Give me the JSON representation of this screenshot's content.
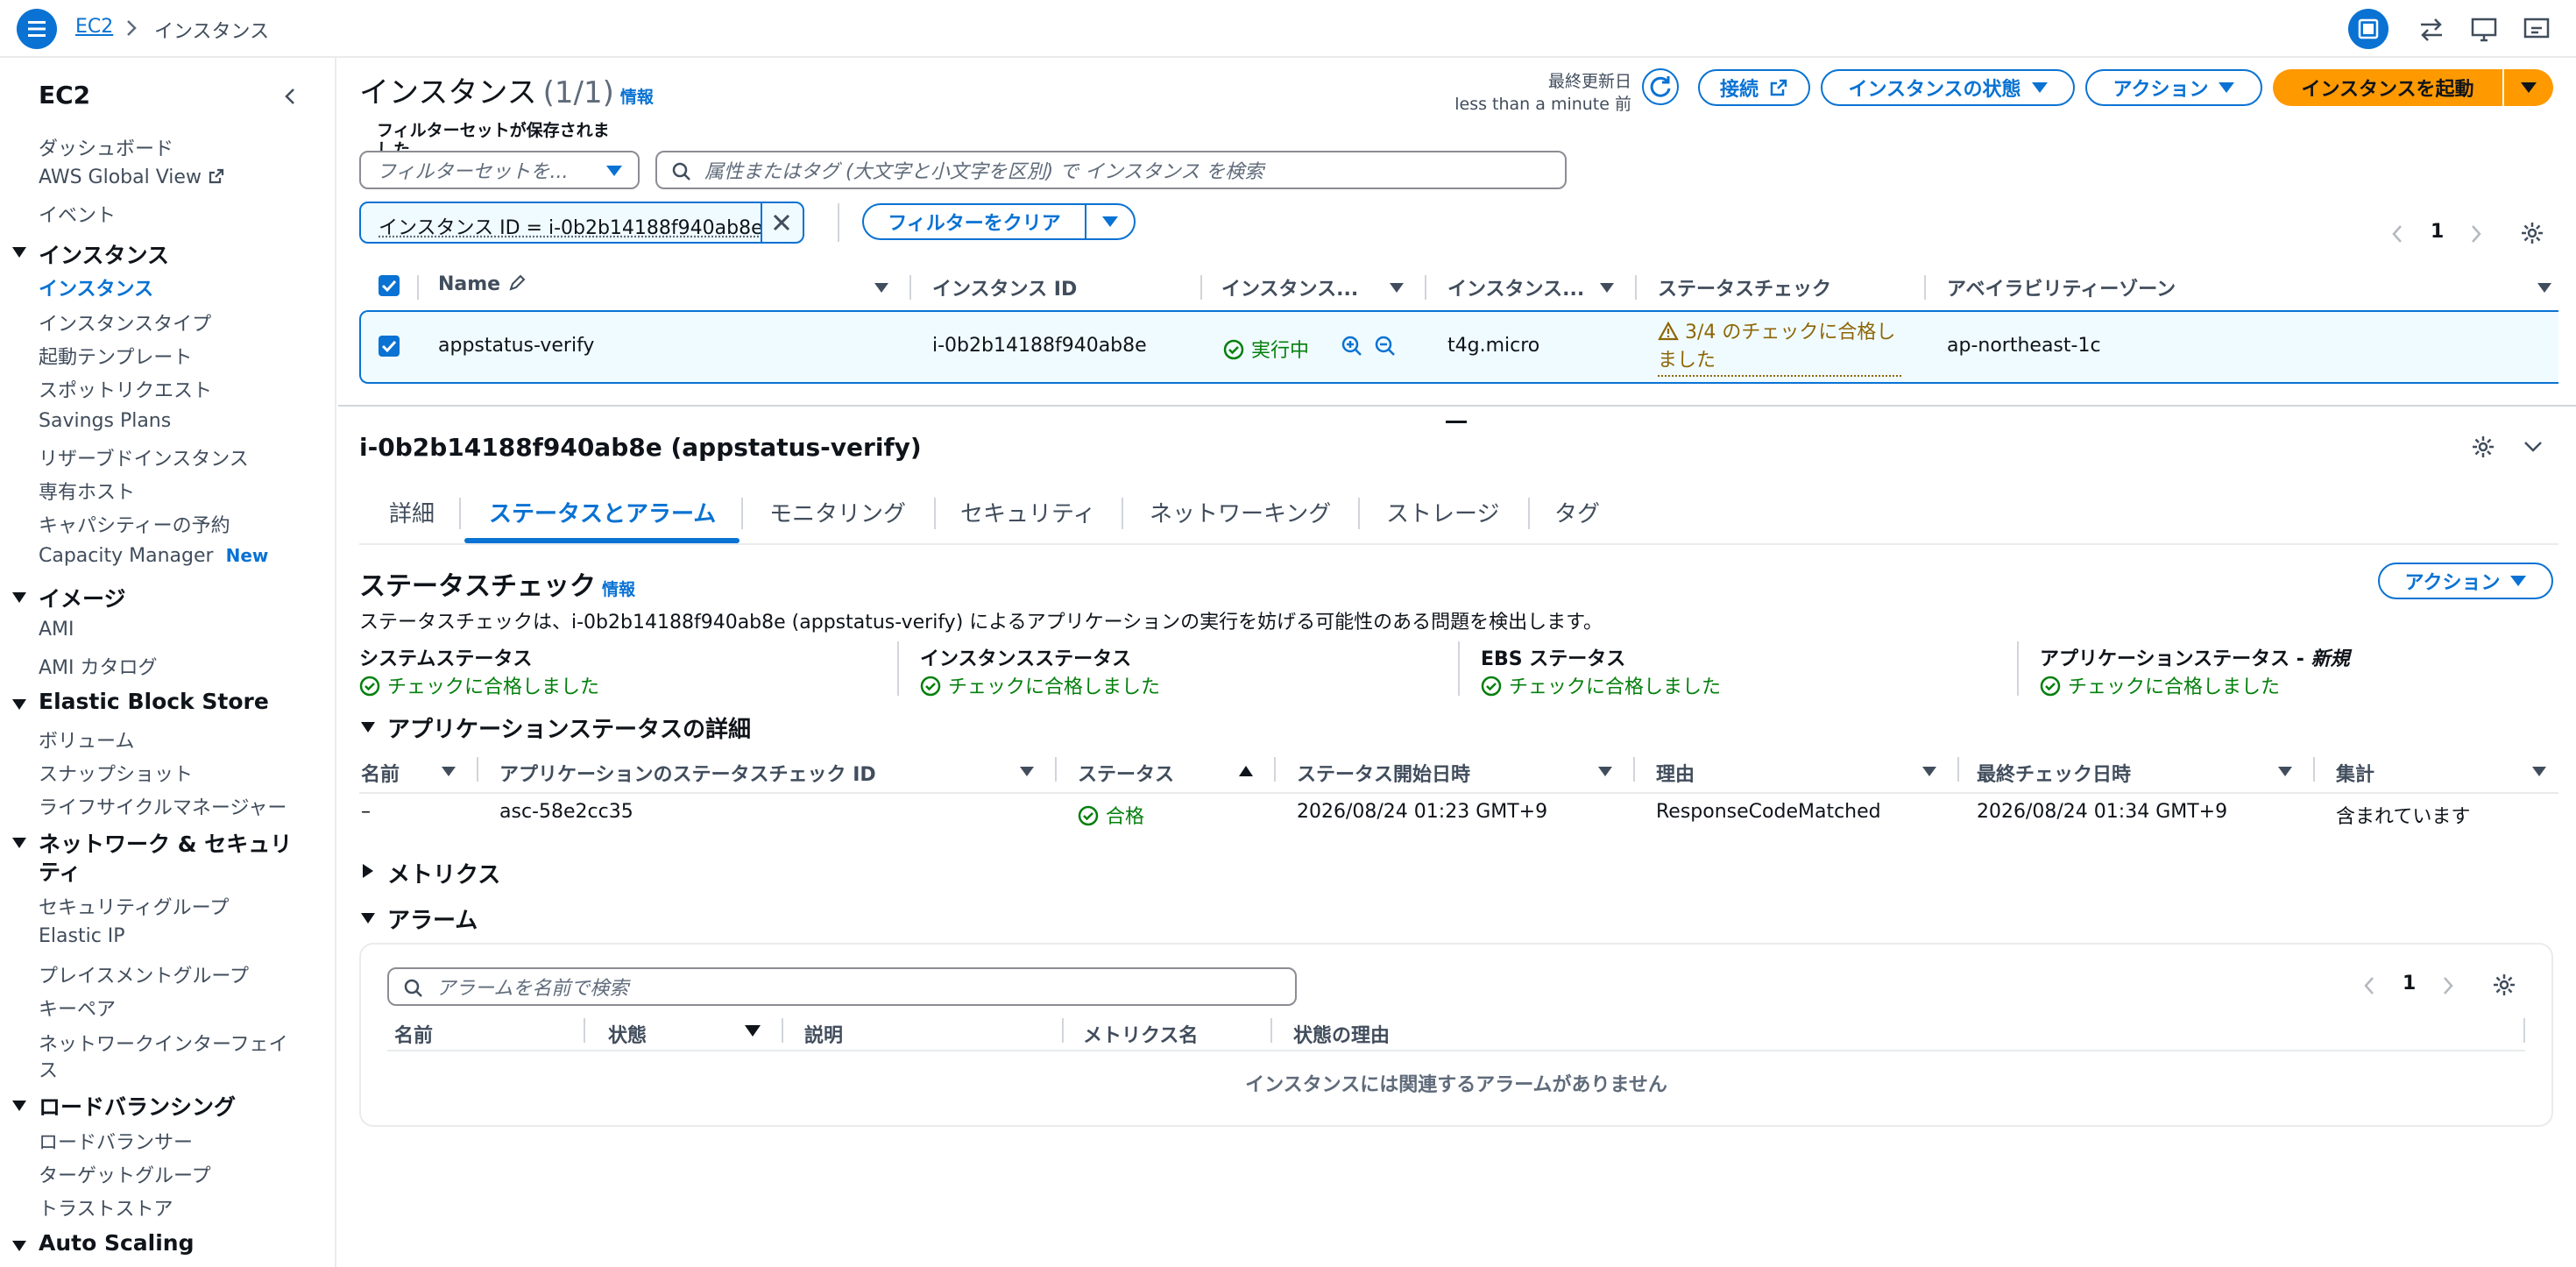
{
  "topbar": {
    "breadcrumb_root": "EC2",
    "breadcrumb_current": "インスタンス"
  },
  "sidebar": {
    "title": "EC2",
    "top_items": [
      "ダッシュボード",
      "AWS Global View",
      "イベント"
    ],
    "sections": [
      {
        "title": "インスタンス",
        "items": [
          "インスタンス",
          "インスタンスタイプ",
          "起動テンプレート",
          "スポットリクエスト",
          "Savings Plans",
          "リザーブドインスタンス",
          "専有ホスト",
          "キャパシティーの予約",
          "Capacity Manager"
        ]
      },
      {
        "title": "イメージ",
        "items": [
          "AMI",
          "AMI カタログ"
        ]
      },
      {
        "title": "Elastic Block Store",
        "items": [
          "ボリューム",
          "スナップショット",
          "ライフサイクルマネージャー"
        ]
      },
      {
        "title_line1": "ネットワーク & セキュリ",
        "title_line2": "ティ",
        "items": [
          "セキュリティグループ",
          "Elastic IP",
          "プレイスメントグループ",
          "キーペア",
          "ネットワークインターフェイ",
          "ス"
        ]
      },
      {
        "title": "ロードバランシング",
        "items": [
          "ロードバランサー",
          "ターゲットグループ",
          "トラストストア"
        ]
      },
      {
        "title": "Auto Scaling"
      }
    ],
    "new_badge": "New"
  },
  "header": {
    "title": "インスタンス",
    "count": "(1/1)",
    "info": "情報",
    "last_updated_label": "最終更新日",
    "last_updated_value": "less than a minute 前",
    "connect": "接続",
    "instance_state": "インスタンスの状態",
    "actions": "アクション",
    "launch": "インスタンスを起動"
  },
  "filters": {
    "saved_label_line1": "フィルターセットが保存されま",
    "saved_label_line2": "した",
    "saved_placeholder": "フィルターセットを...",
    "search_placeholder": "属性またはタグ (大文字と小文字を区別) で インスタンス を検索",
    "token": "インスタンス ID = i-0b2b14188f940ab8e",
    "clear": "フィルターをクリア",
    "page": "1"
  },
  "table": {
    "headers": [
      "Name",
      "インスタンス ID",
      "インスタンス...",
      "インスタンス...",
      "ステータスチェック",
      "アベイラビリティーゾーン"
    ],
    "row": {
      "name": "appstatus-verify",
      "id": "i-0b2b14188f940ab8e",
      "state": "実行中",
      "type": "t4g.micro",
      "checks_line1": "3/4 のチェックに合格し",
      "checks_line2": "ました",
      "az": "ap-northeast-1c"
    }
  },
  "detail": {
    "title": "i-0b2b14188f940ab8e (appstatus-verify)",
    "tabs": [
      "詳細",
      "ステータスとアラーム",
      "モニタリング",
      "セキュリティ",
      "ネットワーキング",
      "ストレージ",
      "タグ"
    ],
    "status_title": "ステータスチェック",
    "info": "情報",
    "actions": "アクション",
    "description": "ステータスチェックは、i-0b2b14188f940ab8e (appstatus-verify) によるアプリケーションの実行を妨げる可能性のある問題を検出します。",
    "checks": [
      {
        "label": "システムステータス",
        "value": "チェックに合格しました"
      },
      {
        "label": "インスタンスステータス",
        "value": "チェックに合格しました"
      },
      {
        "label": "EBS ステータス",
        "value": "チェックに合格しました"
      },
      {
        "label": "アプリケーションステータス - ",
        "label_em": "新規",
        "value": "チェックに合格しました"
      }
    ],
    "app_section": "アプリケーションステータスの詳細",
    "app_headers": [
      "名前",
      "アプリケーションのステータスチェック ID",
      "ステータス",
      "ステータス開始日時",
      "理由",
      "最終チェック日時",
      "集計"
    ],
    "app_row": {
      "name": "–",
      "id": "asc-58e2cc35",
      "status": "合格",
      "start": "2026/08/24 01:23 GMT+9",
      "reason": "ResponseCodeMatched",
      "last": "2026/08/24 01:34 GMT+9",
      "agg": "含まれています"
    },
    "metrics": "メトリクス",
    "alarms": "アラーム",
    "alarm_search": "アラームを名前で検索",
    "alarm_page": "1",
    "alarm_headers": [
      "名前",
      "状態",
      "説明",
      "メトリクス名",
      "状態の理由"
    ],
    "alarm_empty": "インスタンスには関連するアラームがありません"
  },
  "colors": {
    "primary": "#0972d3",
    "launch": "#ff9900",
    "success": "#037f0c",
    "warning": "#8d6605"
  }
}
